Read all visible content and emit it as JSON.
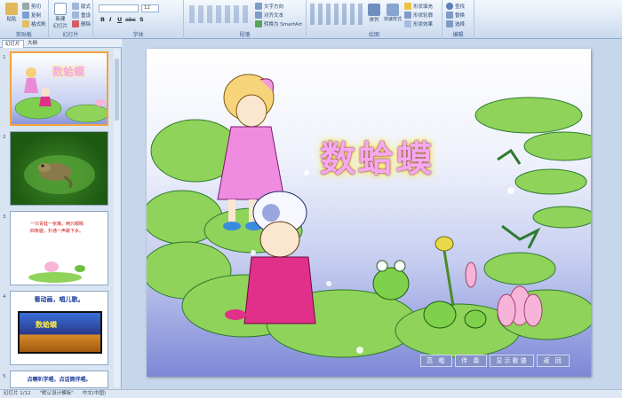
{
  "ribbon": {
    "clipboard": {
      "paste": "粘贴",
      "cut": "剪切",
      "copy": "复制",
      "format_painter": "格式刷",
      "label": "剪贴板"
    },
    "slides": {
      "new_slide": "新建",
      "new_slide2": "幻灯片",
      "layout": "版式",
      "reset": "重设",
      "delete": "删除",
      "label": "幻灯片"
    },
    "font": {
      "font_name": "",
      "font_size": "12",
      "label": "字体",
      "bold": "B",
      "italic": "I",
      "underline": "U",
      "strike": "abc",
      "shadow": "S"
    },
    "paragraph": {
      "text_direction": "文字方向",
      "align_text": "对齐文本",
      "smartart": "转换为 SmartArt",
      "label": "段落"
    },
    "drawing": {
      "arrange": "排列",
      "quick_styles": "快速样式",
      "shape_fill": "形状填充",
      "shape_outline": "形状轮廓",
      "shape_effects": "形状效果",
      "label": "绘图"
    },
    "editing": {
      "find": "查找",
      "replace": "替换",
      "select": "选择",
      "label": "编辑"
    }
  },
  "panel": {
    "tabs": [
      "幻灯片",
      "大纲"
    ],
    "thumbs": [
      {
        "num": "1",
        "title": "数蛤蟆"
      },
      {
        "num": "2"
      },
      {
        "num": "3",
        "poem": "一只青蛙一张嘴，两只眼睛四条腿，扑通一声跳下水。"
      },
      {
        "num": "4",
        "title": "看动画，唱儿歌。",
        "inner_title": "数蛤蟆"
      },
      {
        "num": "5",
        "title": "点喇叭学唱，点话筒伴唱。"
      }
    ]
  },
  "slide": {
    "title": "数蛤蟆",
    "nav": [
      "范 唱",
      "伴 奏",
      "显示歌谱",
      "返 回"
    ]
  },
  "status": {
    "slide_info": "幻灯片 1/12",
    "theme": "\"默认设计模板\"",
    "language": "中文(中国)"
  },
  "colors": {
    "title": "#f6a8ef",
    "glow": "#ffe94a",
    "lily_pad": "#8fd35a",
    "nav_button": "#8592c9"
  }
}
